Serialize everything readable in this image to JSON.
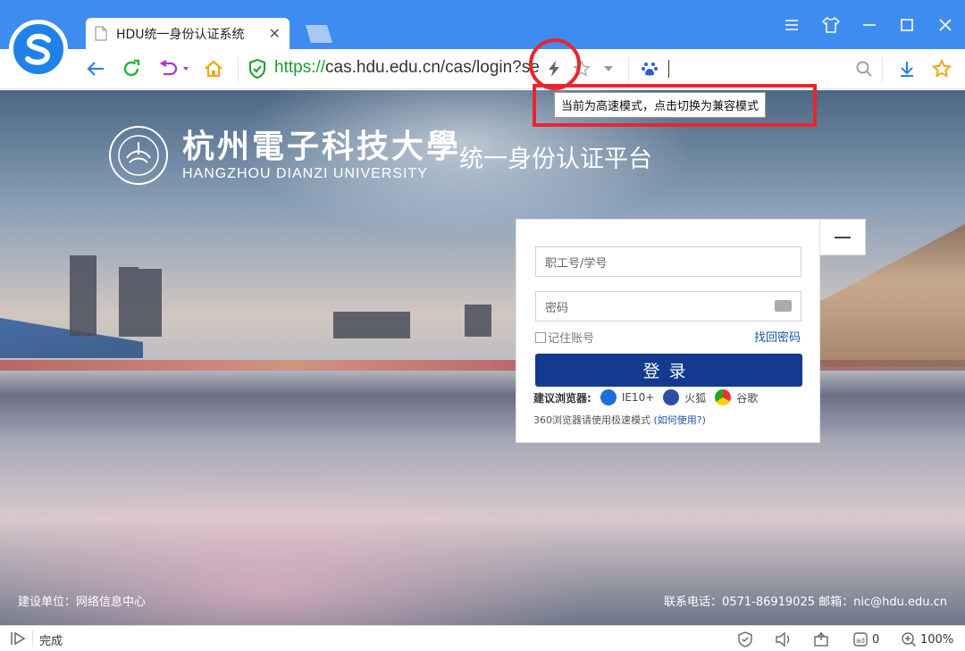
{
  "browser": {
    "tab_title": "HDU统一身份认证系统",
    "tab_close": "✕",
    "url_protocol": "https://",
    "url_rest": "cas.hdu.edu.cn/cas/login?se",
    "tooltip": "当前为高速模式，点击切换为兼容模式"
  },
  "brand": {
    "name_cn": "杭州電子科技大學",
    "name_en": "HANGZHOU DIANZI UNIVERSITY",
    "platform_title": "统一身份认证平台"
  },
  "login": {
    "username_placeholder": "职工号/学号",
    "password_placeholder": "密码",
    "remember_label": "记住账号",
    "forgot_link": "找回密码",
    "submit_label": "登录",
    "recommend_label": "建议浏览器:",
    "browsers": [
      "IE10+",
      "火狐",
      "谷歌"
    ],
    "tip_360": "360浏览器请使用极速模式",
    "tip_how": "(如何使用?)"
  },
  "footer": {
    "left": "建设单位：网络信息中心",
    "right": "联系电话：0571-86919025 邮箱：nic@hdu.edu.cn"
  },
  "status": {
    "text": "完成",
    "download_count": "0",
    "zoom": "100%"
  },
  "colors": {
    "titlebar": "#3f8cf0",
    "login_button": "#133a8e",
    "annotation": "#e8262c",
    "link": "#1a54a8"
  }
}
